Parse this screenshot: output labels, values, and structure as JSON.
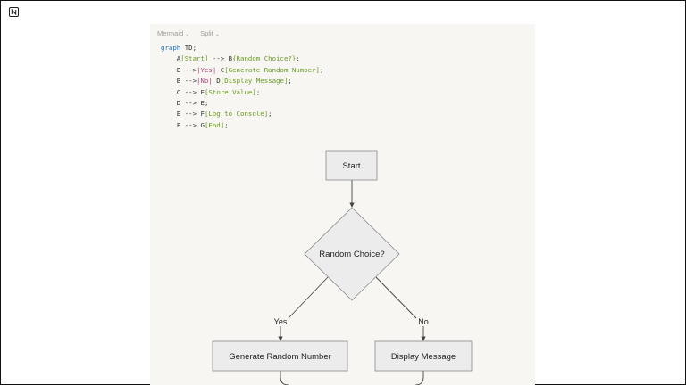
{
  "toolbar": {
    "language_label": "Mermaid",
    "view_label": "Split"
  },
  "code_lines": [
    [
      {
        "t": "graph",
        "c": "k"
      },
      {
        "t": " TD;"
      }
    ],
    [
      {
        "t": "    A"
      },
      {
        "t": "[Start]",
        "c": "s"
      },
      {
        "t": " --> B"
      },
      {
        "t": "{Random Choice?}",
        "c": "s"
      },
      {
        "t": ";"
      }
    ],
    [
      {
        "t": "    B -->"
      },
      {
        "t": "|Yes|",
        "c": "p"
      },
      {
        "t": " C"
      },
      {
        "t": "[Generate Random Number]",
        "c": "s"
      },
      {
        "t": ";"
      }
    ],
    [
      {
        "t": "    B -->"
      },
      {
        "t": "|No|",
        "c": "p"
      },
      {
        "t": " D"
      },
      {
        "t": "[Display Message]",
        "c": "s"
      },
      {
        "t": ";"
      }
    ],
    [
      {
        "t": "    C --> E"
      },
      {
        "t": "[Store Value]",
        "c": "s"
      },
      {
        "t": ";"
      }
    ],
    [
      {
        "t": "    D --> E;"
      }
    ],
    [
      {
        "t": "    E --> F"
      },
      {
        "t": "[Log to Console]",
        "c": "s"
      },
      {
        "t": ";"
      }
    ],
    [
      {
        "t": "    F --> G"
      },
      {
        "t": "[End]",
        "c": "s"
      },
      {
        "t": ";"
      }
    ]
  ],
  "diagram": {
    "nodes": {
      "start": "Start",
      "decision": "Random Choice?",
      "generate": "Generate Random Number",
      "display": "Display Message"
    },
    "edge_labels": {
      "yes": "Yes",
      "no": "No"
    }
  }
}
